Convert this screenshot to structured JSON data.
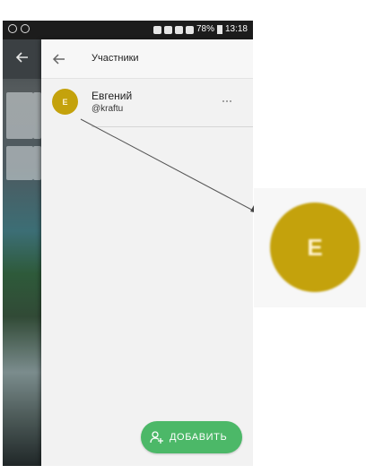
{
  "status_bar": {
    "battery_text": "78%",
    "time": "13:18"
  },
  "header": {
    "title": "Участники"
  },
  "members": [
    {
      "initial": "E",
      "name": "Евгений",
      "username": "@kraftu"
    }
  ],
  "zoom": {
    "initial": "E"
  },
  "actions": {
    "add_label": "ДОБАВИТЬ"
  },
  "colors": {
    "avatar": "#c4a20c",
    "add_button": "#4cb868",
    "panel_bg": "#f2f2f2"
  },
  "icons": {
    "back": "arrow-left-icon",
    "more": "more-horizontal-icon",
    "add_user": "add-user-icon"
  }
}
